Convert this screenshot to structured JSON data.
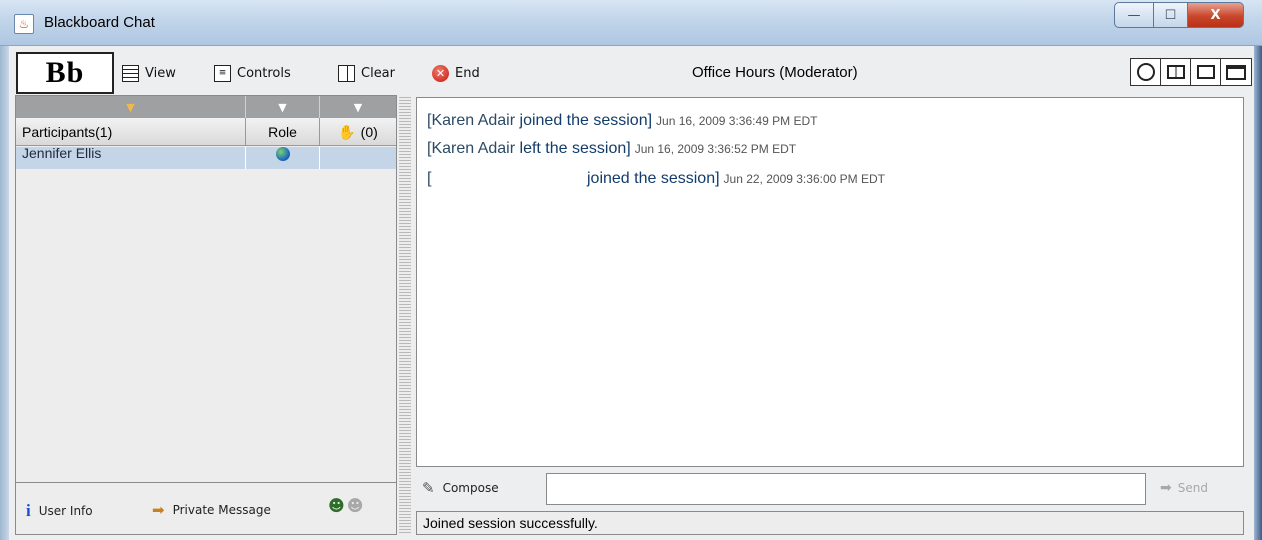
{
  "window": {
    "title": "Blackboard Chat",
    "app_icon": "java-icon",
    "controls": {
      "minimize": "—",
      "maximize": "☐",
      "close": "X"
    }
  },
  "toolbar": {
    "logo": "Bb",
    "view_label": "View",
    "controls_label": "Controls",
    "clear_label": "Clear",
    "end_label": "End",
    "session_title": "Office Hours (Moderator)"
  },
  "participants": {
    "sort_indicators": [
      "▼",
      "▼",
      "▼"
    ],
    "headers": {
      "name": "Participants(1)",
      "role": "Role",
      "hand_count": "(0)"
    },
    "rows": [
      {
        "name": "Jennifer Ellis",
        "role_icon": "globe-icon"
      }
    ],
    "actions": {
      "user_info": "User Info",
      "private_message": "Private Message"
    }
  },
  "chat": {
    "messages": [
      {
        "who": "[Karen Adair",
        "text": " joined the session]",
        "time": "Jun 16, 2009 3:36:49 PM EDT"
      },
      {
        "who": "[Karen Adair",
        "text": " left the session]",
        "time": "Jun 16, 2009 3:36:52 PM EDT"
      },
      {
        "who": "[",
        "text": "joined the session]",
        "time": "Jun 22, 2009 3:36:00 PM EDT"
      }
    ],
    "compose_label": "Compose",
    "compose_value": "",
    "send_label": "Send",
    "status": "Joined session successfully."
  },
  "colors": {
    "selection": "#c4d5e7",
    "sort_bar": "#9fa0a2",
    "end_icon": "#c41a10",
    "info_icon": "#1a4fd0"
  }
}
